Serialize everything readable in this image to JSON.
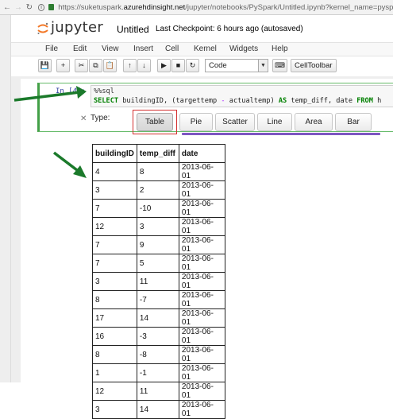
{
  "browser": {
    "url_prefix": "https://suketuspark.",
    "url_host": "azurehdinsight.net",
    "url_path": "/jupyter/notebooks/PySpark/Untitled.ipynb?kernel_name=pyspark"
  },
  "header": {
    "logo_text": "jupyter",
    "notebook_title": "Untitled",
    "checkpoint": "Last Checkpoint: 6 hours ago (autosaved)"
  },
  "menu": [
    "File",
    "Edit",
    "View",
    "Insert",
    "Cell",
    "Kernel",
    "Widgets",
    "Help"
  ],
  "toolbar": {
    "icons": [
      "save-icon",
      "plus-icon",
      "scissors-icon",
      "copy-icon",
      "paste-icon",
      "arrow-up-icon",
      "arrow-down-icon",
      "run-icon",
      "stop-icon",
      "restart-icon",
      "keyboard-icon"
    ],
    "glyphs": [
      "💾",
      "+",
      "✂",
      "⧉",
      "📋",
      "↑",
      "↓",
      "▶",
      "■",
      "↻",
      "⌨"
    ],
    "cell_type": "Code",
    "celltoolbar_label": "CellToolbar"
  },
  "cell": {
    "prompt": "In [4]:",
    "code_line1": "%%sql",
    "code_line2_kw1": "SELECT",
    "code_line2_a": " buildingID, (targettemp ",
    "code_line2_op": "-",
    "code_line2_b": " actualtemp) ",
    "code_line2_kw2": "AS",
    "code_line2_c": " temp_diff, date ",
    "code_line2_kw3": "FROM",
    "code_line2_d": " h"
  },
  "output": {
    "type_label": "Type:",
    "close_glyph": "✕",
    "buttons": [
      "Table",
      "Pie",
      "Scatter",
      "Line",
      "Area",
      "Bar"
    ],
    "selected": "Table"
  },
  "table": {
    "columns": [
      "buildingID",
      "temp_diff",
      "date"
    ],
    "rows": [
      [
        "4",
        "8",
        "2013-06-01"
      ],
      [
        "3",
        "2",
        "2013-06-01"
      ],
      [
        "7",
        "-10",
        "2013-06-01"
      ],
      [
        "12",
        "3",
        "2013-06-01"
      ],
      [
        "7",
        "9",
        "2013-06-01"
      ],
      [
        "7",
        "5",
        "2013-06-01"
      ],
      [
        "3",
        "11",
        "2013-06-01"
      ],
      [
        "8",
        "-7",
        "2013-06-01"
      ],
      [
        "17",
        "14",
        "2013-06-01"
      ],
      [
        "16",
        "-3",
        "2013-06-01"
      ],
      [
        "8",
        "-8",
        "2013-06-01"
      ],
      [
        "1",
        "-1",
        "2013-06-01"
      ],
      [
        "12",
        "11",
        "2013-06-01"
      ],
      [
        "3",
        "14",
        "2013-06-01"
      ]
    ]
  },
  "colors": {
    "arrow_green": "#1b7a2b",
    "highlight_red": "#d32f2f",
    "underline_purple": "#7e57c2",
    "logo_orange": "#f37726"
  }
}
